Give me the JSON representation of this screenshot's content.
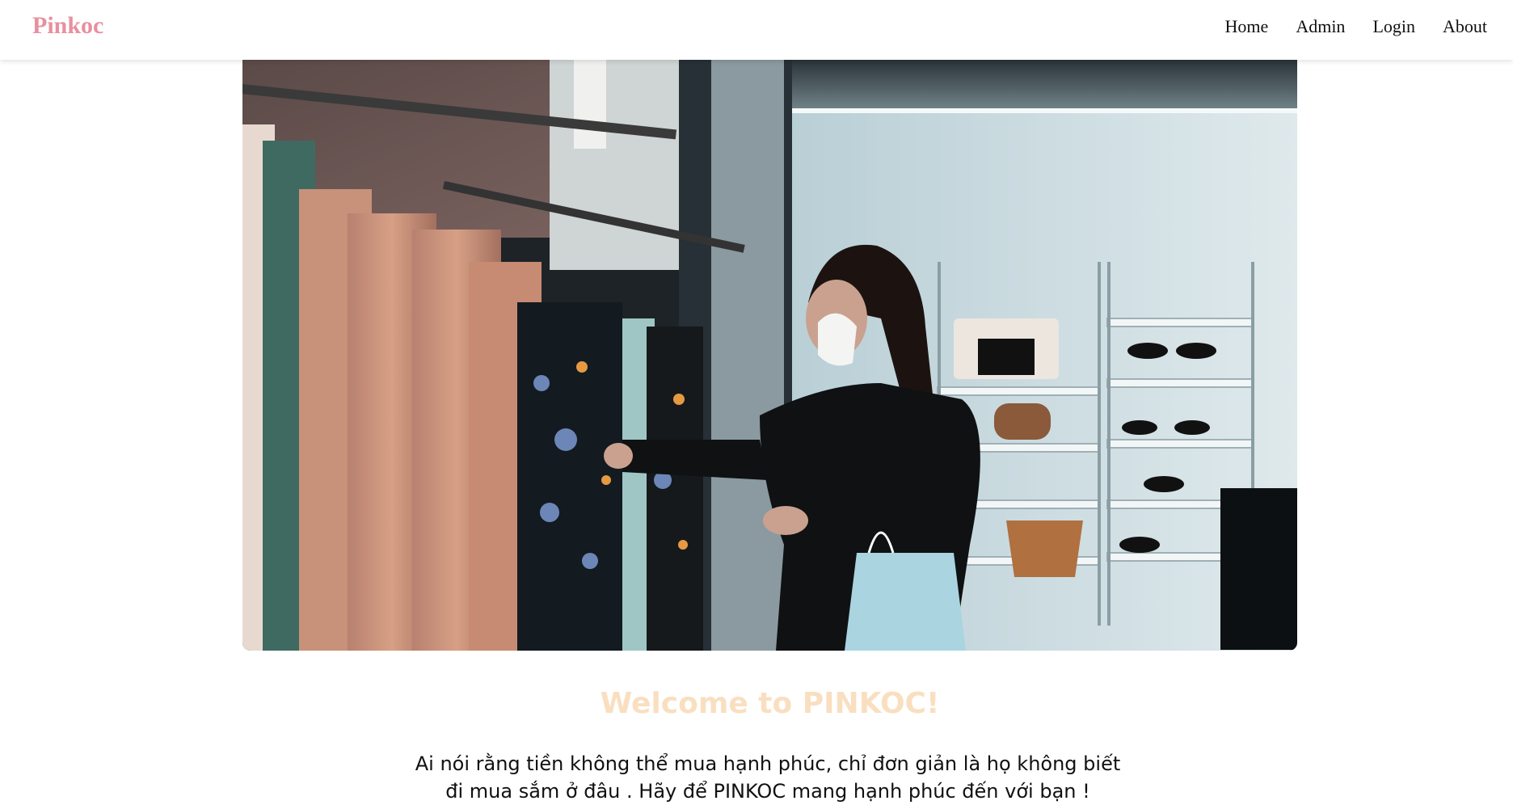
{
  "brand": {
    "name": "Pinkoc",
    "color": "#e8909f"
  },
  "nav": {
    "items": [
      {
        "label": "Home"
      },
      {
        "label": "Admin"
      },
      {
        "label": "Login"
      },
      {
        "label": "About"
      }
    ]
  },
  "hero": {
    "image_icon": "hero-photo-shopping-woman"
  },
  "main": {
    "welcome_title": "Welcome to PINKOC!",
    "welcome_color": "#f9dfc0",
    "tagline": "Ai nói rằng tiền không thể mua hạnh phúc, chỉ đơn giản là họ không biết đi mua sắm ở đâu . Hãy để PINKOC mang hạnh phúc đến với bạn !"
  }
}
